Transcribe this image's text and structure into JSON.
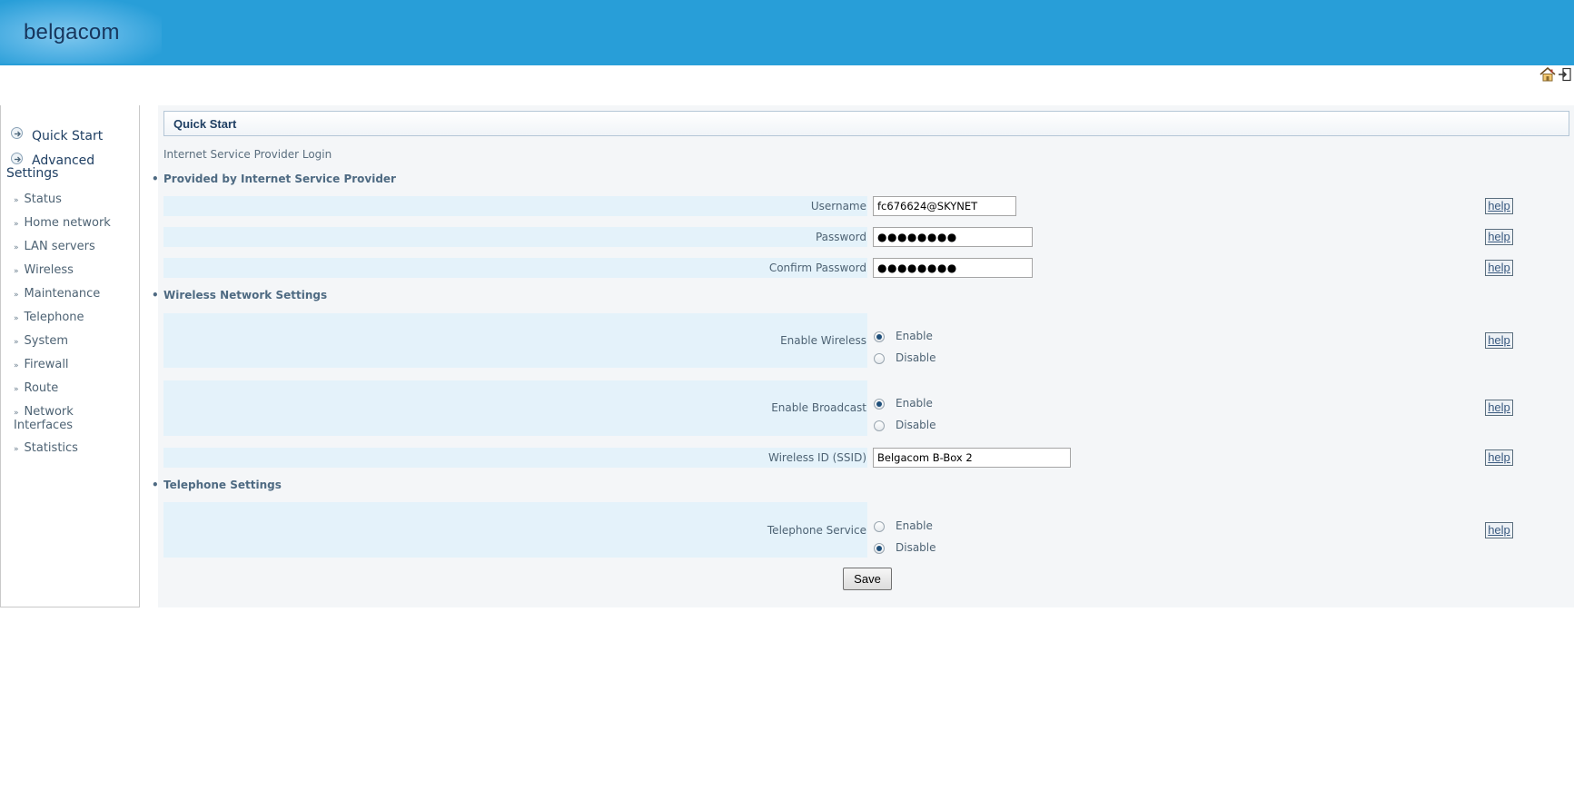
{
  "header": {
    "logo_text": "belgacom",
    "brand_color": "#289ed8"
  },
  "top_icons": [
    {
      "icon": "home-icon"
    },
    {
      "icon": "logout-icon"
    }
  ],
  "sidebar": {
    "top_items": [
      {
        "label": "Quick Start",
        "icon": "circle-arrow-icon"
      },
      {
        "label": "Advanced\nSettings",
        "icon": "circle-arrow-icon"
      }
    ],
    "sub_items": [
      {
        "label": "Status"
      },
      {
        "label": "Home network"
      },
      {
        "label": "LAN servers"
      },
      {
        "label": "Wireless"
      },
      {
        "label": "Maintenance"
      },
      {
        "label": "Telephone"
      },
      {
        "label": "System"
      },
      {
        "label": "Firewall"
      },
      {
        "label": "Route"
      },
      {
        "label": "Network\nInterfaces"
      },
      {
        "label": "Statistics"
      }
    ]
  },
  "main": {
    "title": "Quick Start",
    "intro": "Internet Service Provider Login",
    "sections": {
      "isp": {
        "heading": "Provided by Internet Service Provider",
        "username_label": "Username",
        "username_value": "fc676624@SKYNET",
        "password_label": "Password",
        "password_value": "●●●●●●●●",
        "confirm_label": "Confirm Password",
        "confirm_value": "●●●●●●●●"
      },
      "wireless": {
        "heading": "Wireless Network Settings",
        "enable_wireless_label": "Enable Wireless",
        "enable_broadcast_label": "Enable Broadcast",
        "ssid_label": "Wireless ID (SSID)",
        "ssid_value": "Belgacom B-Box 2"
      },
      "telephone": {
        "heading": "Telephone Settings",
        "service_label": "Telephone Service"
      }
    },
    "radio_enable": "Enable",
    "radio_disable": "Disable",
    "help_label": "help",
    "save_label": "Save"
  }
}
